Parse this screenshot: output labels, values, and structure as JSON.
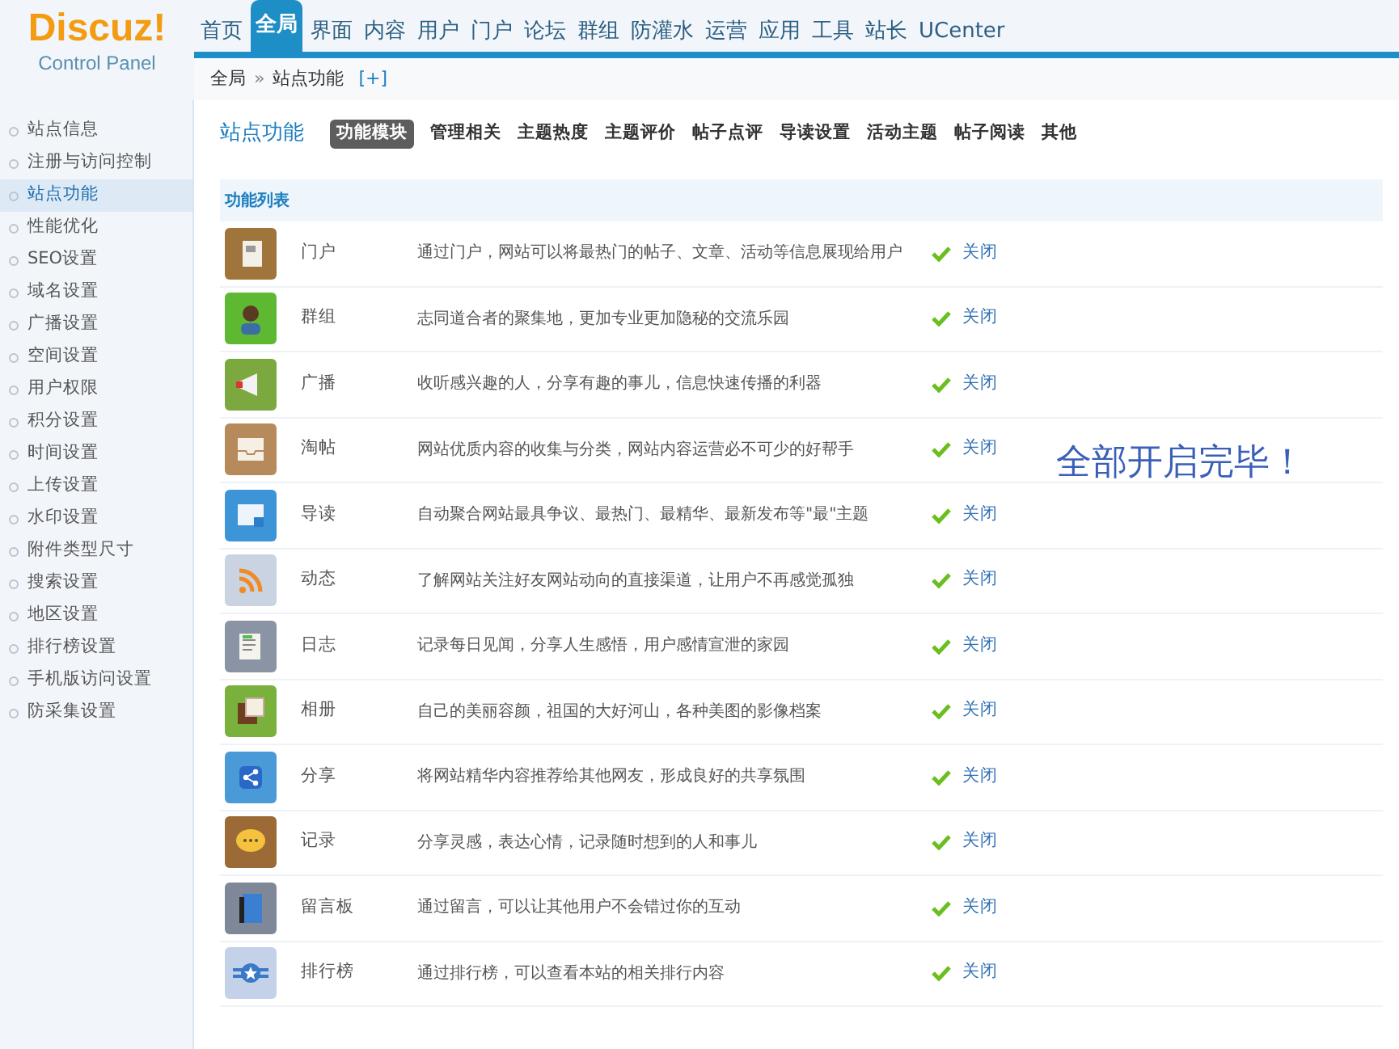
{
  "logo": {
    "title": "Discuz!",
    "subtitle": "Control Panel"
  },
  "top_nav": [
    {
      "label": "首页",
      "selected": false
    },
    {
      "label": "全局",
      "selected": true
    },
    {
      "label": "界面",
      "selected": false
    },
    {
      "label": "内容",
      "selected": false
    },
    {
      "label": "用户",
      "selected": false
    },
    {
      "label": "门户",
      "selected": false
    },
    {
      "label": "论坛",
      "selected": false
    },
    {
      "label": "群组",
      "selected": false
    },
    {
      "label": "防灌水",
      "selected": false
    },
    {
      "label": "运营",
      "selected": false
    },
    {
      "label": "应用",
      "selected": false
    },
    {
      "label": "工具",
      "selected": false
    },
    {
      "label": "站长",
      "selected": false
    },
    {
      "label": "UCenter",
      "selected": false
    }
  ],
  "breadcrumb": {
    "items": [
      "全局",
      "站点功能"
    ],
    "separator": "»",
    "add": "[+]"
  },
  "sidebar": {
    "items": [
      {
        "label": "站点信息",
        "selected": false
      },
      {
        "label": "注册与访问控制",
        "selected": false
      },
      {
        "label": "站点功能",
        "selected": true
      },
      {
        "label": "性能优化",
        "selected": false
      },
      {
        "label": "SEO设置",
        "selected": false
      },
      {
        "label": "域名设置",
        "selected": false
      },
      {
        "label": "广播设置",
        "selected": false
      },
      {
        "label": "空间设置",
        "selected": false
      },
      {
        "label": "用户权限",
        "selected": false
      },
      {
        "label": "积分设置",
        "selected": false
      },
      {
        "label": "时间设置",
        "selected": false
      },
      {
        "label": "上传设置",
        "selected": false
      },
      {
        "label": "水印设置",
        "selected": false
      },
      {
        "label": "附件类型尺寸",
        "selected": false
      },
      {
        "label": "搜索设置",
        "selected": false
      },
      {
        "label": "地区设置",
        "selected": false
      },
      {
        "label": "排行榜设置",
        "selected": false
      },
      {
        "label": "手机版访问设置",
        "selected": false
      },
      {
        "label": "防采集设置",
        "selected": false
      }
    ]
  },
  "page_title": "站点功能",
  "tabs": [
    {
      "label": "功能模块",
      "selected": true
    },
    {
      "label": "管理相关",
      "selected": false
    },
    {
      "label": "主题热度",
      "selected": false
    },
    {
      "label": "主题评价",
      "selected": false
    },
    {
      "label": "帖子点评",
      "selected": false
    },
    {
      "label": "导读设置",
      "selected": false
    },
    {
      "label": "活动主题",
      "selected": false
    },
    {
      "label": "帖子阅读",
      "selected": false
    },
    {
      "label": "其他",
      "selected": false
    }
  ],
  "section_title": "功能列表",
  "features": [
    {
      "name": "门户",
      "description": "通过门户，网站可以将最热门的帖子、文章、活动等信息展现给用户",
      "enabled": true,
      "action": "关闭"
    },
    {
      "name": "群组",
      "description": "志同道合者的聚集地，更加专业更加隐秘的交流乐园",
      "enabled": true,
      "action": "关闭"
    },
    {
      "name": "广播",
      "description": "收听感兴趣的人，分享有趣的事儿，信息快速传播的利器",
      "enabled": true,
      "action": "关闭"
    },
    {
      "name": "淘帖",
      "description": "网站优质内容的收集与分类，网站内容运营必不可少的好帮手",
      "enabled": true,
      "action": "关闭"
    },
    {
      "name": "导读",
      "description": "自动聚合网站最具争议、最热门、最精华、最新发布等\"最\"主题",
      "enabled": true,
      "action": "关闭"
    },
    {
      "name": "动态",
      "description": "了解网站关注好友网站动向的直接渠道，让用户不再感觉孤独",
      "enabled": true,
      "action": "关闭"
    },
    {
      "name": "日志",
      "description": "记录每日见闻，分享人生感悟，用户感情宣泄的家园",
      "enabled": true,
      "action": "关闭"
    },
    {
      "name": "相册",
      "description": "自己的美丽容颜，祖国的大好河山，各种美图的影像档案",
      "enabled": true,
      "action": "关闭"
    },
    {
      "name": "分享",
      "description": "将网站精华内容推荐给其他网友，形成良好的共享氛围",
      "enabled": true,
      "action": "关闭"
    },
    {
      "name": "记录",
      "description": "分享灵感，表达心情，记录随时想到的人和事儿",
      "enabled": true,
      "action": "关闭"
    },
    {
      "name": "留言板",
      "description": "通过留言，可以让其他用户不会错过你的互动",
      "enabled": true,
      "action": "关闭"
    },
    {
      "name": "排行榜",
      "description": "通过排行榜，可以查看本站的相关排行内容",
      "enabled": true,
      "action": "关闭"
    }
  ],
  "overlay_note": "全部开启完毕！"
}
